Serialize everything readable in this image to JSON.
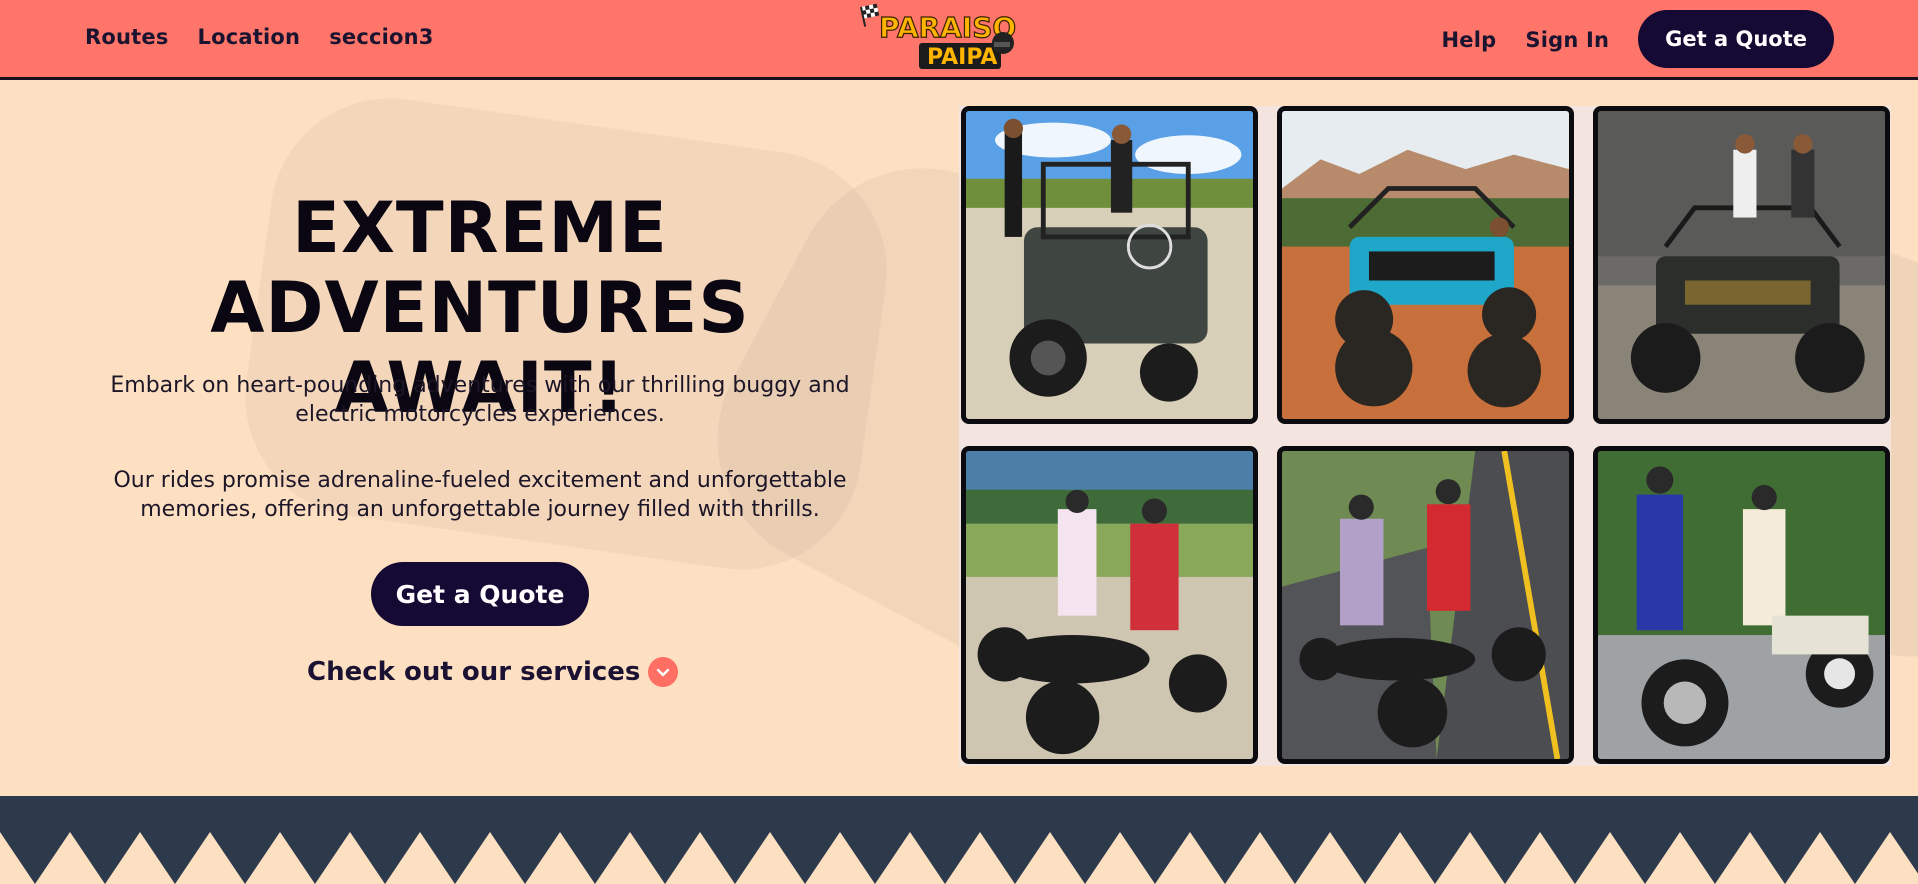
{
  "header": {
    "nav_left": [
      "Routes",
      "Location",
      "seccion3"
    ],
    "nav_right": [
      "Help",
      "Sign In"
    ],
    "quote_label": "Get a Quote",
    "logo": {
      "line1": "PARAISO",
      "line2": "PAIPA"
    }
  },
  "hero": {
    "title_line1": "EXTREME",
    "title_line2": "ADVENTURES AWAIT!",
    "paragraph1": "Embark on heart-pounding adventures with our thrilling buggy and electric motorcycles experiences.",
    "paragraph2": "Our rides promise adrenaline-fueled excitement and unforgettable memories, offering an unforgettable journey filled with thrills.",
    "quote_label": "Get a Quote",
    "services_label": "Check out our services"
  },
  "gallery": [
    {
      "icon": "jeep-photo"
    },
    {
      "icon": "buggy-photo"
    },
    {
      "icon": "buggy-photo"
    },
    {
      "icon": "electric-scooter-photo"
    },
    {
      "icon": "electric-scooter-photo"
    },
    {
      "icon": "electric-scooter-photo"
    }
  ],
  "colors": {
    "header_bg": "#ff7569",
    "page_bg": "#fde0c2",
    "button_bg": "#150a33",
    "accent": "#ff6f63",
    "band": "#2d3a4c"
  }
}
